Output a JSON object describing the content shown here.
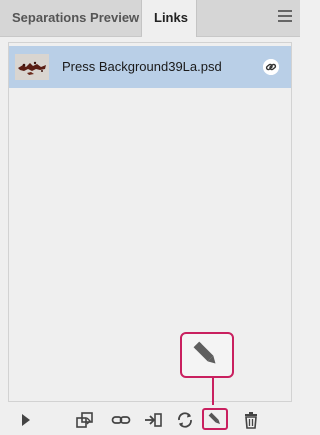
{
  "tabs": [
    {
      "label": "Separations Preview",
      "active": false
    },
    {
      "label": "Links",
      "active": true
    }
  ],
  "menu_icon": "hamburger-menu-icon",
  "links": [
    {
      "filename": "Press Background39La.psd",
      "status_icon": "embedded-link-icon",
      "selected": true
    }
  ],
  "callout": {
    "icon": "pencil-icon",
    "accent": "#c9205f"
  },
  "toolbar": {
    "buttons": [
      {
        "icon": "play-icon"
      },
      {
        "icon": "relink-to-folder-icon"
      },
      {
        "icon": "relink-icon"
      },
      {
        "icon": "go-to-link-icon"
      },
      {
        "icon": "update-link-icon"
      },
      {
        "icon": "edit-original-icon",
        "highlighted": true
      },
      {
        "icon": "trash-icon"
      }
    ]
  },
  "colors": {
    "selection": "#b9cfe7",
    "tabbar": "#d6d6d6",
    "panel": "#efefef",
    "accent": "#c9205f"
  }
}
